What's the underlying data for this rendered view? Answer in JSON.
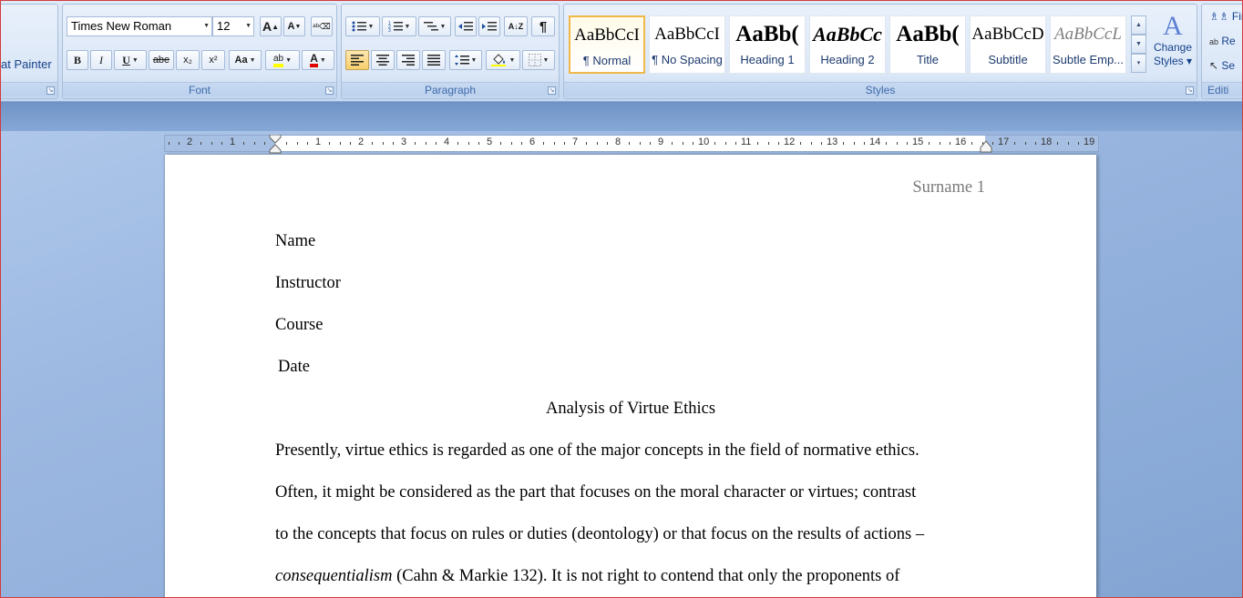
{
  "ribbon": {
    "clipboard": {
      "format_painter_label": "at Painter"
    },
    "font": {
      "group_label": "Font",
      "font_name": "Times New Roman",
      "font_size": "12",
      "grow_label": "A",
      "shrink_label": "A",
      "bold_label": "B",
      "italic_label": "I",
      "underline_label": "U",
      "strike_label": "abe",
      "subscript_label": "x₂",
      "superscript_label": "x²",
      "change_case_label": "Aa",
      "highlight_label": "ab",
      "font_color_label": "A",
      "highlight_color": "#ffff00",
      "font_color": "#e00000"
    },
    "paragraph": {
      "group_label": "Paragraph",
      "sort_label": "A↓Z",
      "show_marks_label": "¶"
    },
    "styles": {
      "group_label": "Styles",
      "gallery": [
        {
          "sample": "AaBbCcI",
          "name": "¶ Normal",
          "selected": true
        },
        {
          "sample": "AaBbCcI",
          "name": "¶ No Spacing",
          "selected": false
        },
        {
          "sample": "AaBb(",
          "name": "Heading 1",
          "selected": false
        },
        {
          "sample": "AaBbCc",
          "name": "Heading 2",
          "selected": false
        },
        {
          "sample": "AaBb(",
          "name": "Title",
          "selected": false
        },
        {
          "sample": "AaBbCcD",
          "name": "Subtitle",
          "selected": false
        },
        {
          "sample": "AaBbCcL",
          "name": "Subtle Emp...",
          "selected": false
        }
      ],
      "change_styles_line1": "Change",
      "change_styles_line2": "Styles ▾"
    },
    "editing": {
      "group_label": "Editi",
      "find_label": "Fin",
      "replace_label": "Re",
      "select_label": "Se"
    }
  },
  "ruler": {
    "labels_left": [
      "2",
      "1"
    ],
    "labels_right": [
      "1",
      "2",
      "3",
      "4",
      "5",
      "6",
      "7",
      "8",
      "9",
      "10",
      "11",
      "12",
      "13",
      "14",
      "15",
      "16",
      "17",
      "18",
      "19"
    ]
  },
  "document": {
    "header": "Surname 1",
    "lines": {
      "name": "Name",
      "instructor": "Instructor",
      "course": "Course",
      "date": "Date",
      "title": "Analysis of Virtue Ethics",
      "p1": "Presently, virtue ethics is regarded as one of the major concepts in the field of normative ethics.",
      "p2": "Often, it might be considered as the part that focuses on the moral character or virtues; contrast",
      "p3": "to the concepts that focus on rules or duties (deontology) or that focus on the results of actions –",
      "p4_italic": "consequentialism",
      "p4_rest": " (Cahn & Markie 132). It is not right to contend that only the proponents of"
    }
  }
}
